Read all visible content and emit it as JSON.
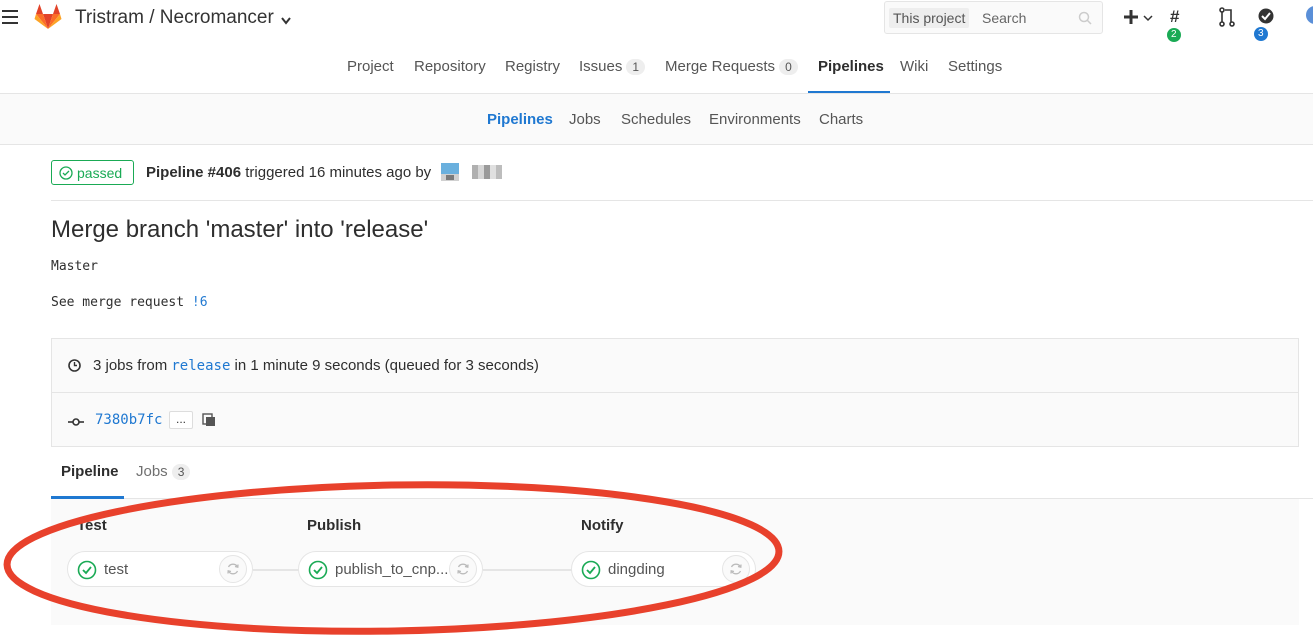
{
  "header": {
    "title": "Tristram / Necromancer",
    "search_scope": "This project",
    "search_placeholder": "Search",
    "issues_badge": "2",
    "todos_badge": "3",
    "icons": [
      "hamburger-icon",
      "gitlab-logo",
      "chevron-down-icon",
      "search-icon",
      "plus-icon",
      "issues-icon",
      "merge-request-icon",
      "todo-icon"
    ]
  },
  "project_nav": {
    "items": [
      {
        "label": "Project"
      },
      {
        "label": "Repository"
      },
      {
        "label": "Registry"
      },
      {
        "label": "Issues",
        "count": "1"
      },
      {
        "label": "Merge Requests",
        "count": "0"
      },
      {
        "label": "Pipelines",
        "active": true
      },
      {
        "label": "Wiki"
      },
      {
        "label": "Settings"
      }
    ]
  },
  "sub_nav": {
    "items": [
      {
        "label": "Pipelines",
        "active": true
      },
      {
        "label": "Jobs"
      },
      {
        "label": "Schedules"
      },
      {
        "label": "Environments"
      },
      {
        "label": "Charts"
      }
    ]
  },
  "pipeline": {
    "status": "passed",
    "id_label": "Pipeline #406",
    "triggered_text": " triggered 16 minutes ago by",
    "commit_title": "Merge branch 'master' into 'release'",
    "description_line1": "Master",
    "description_line2_prefix": "See merge request ",
    "merge_request_ref": "!6",
    "jobs_summary_prefix": "3 jobs from ",
    "branch": "release",
    "jobs_summary_suffix": " in 1 minute 9 seconds (queued for 3 seconds)",
    "commit_sha": "7380b7fc",
    "ellipsis": "...",
    "colors": {
      "success": "#1aaa55",
      "link": "#1f78d1",
      "highlight": "#e8412c"
    }
  },
  "tabs": {
    "pipeline_label": "Pipeline",
    "jobs_label": "Jobs",
    "jobs_count": "3"
  },
  "stages": [
    {
      "title": "Test",
      "job": "test"
    },
    {
      "title": "Publish",
      "job": "publish_to_cnp..."
    },
    {
      "title": "Notify",
      "job": "dingding"
    }
  ]
}
